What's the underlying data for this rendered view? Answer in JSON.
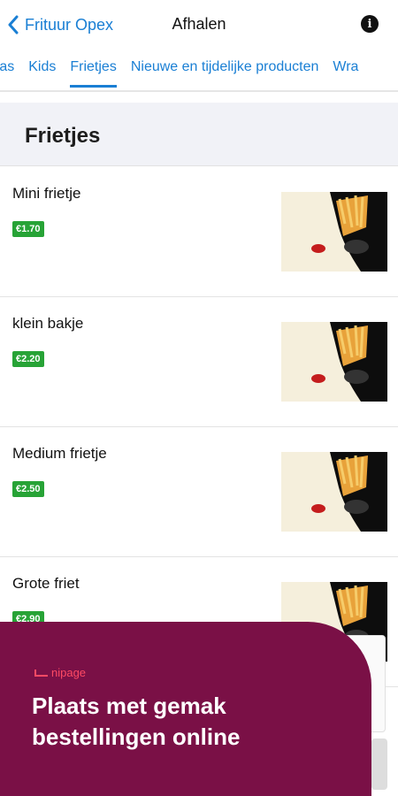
{
  "header": {
    "back_label": "Frituur Opex",
    "title": "Afhalen",
    "info_icon": "i"
  },
  "tabs": [
    {
      "label": "gtas",
      "active": false
    },
    {
      "label": "Kids",
      "active": false
    },
    {
      "label": "Frietjes",
      "active": true
    },
    {
      "label": "Nieuwe en tijdelijke producten",
      "active": false
    },
    {
      "label": "Wra",
      "active": false
    }
  ],
  "section": {
    "title": "Frietjes"
  },
  "items": [
    {
      "name": "Mini frietje",
      "price": "€1.70",
      "image_icon": "fries-cone-image"
    },
    {
      "name": "klein bakje",
      "price": "€2.20",
      "image_icon": "fries-cone-image"
    },
    {
      "name": "Medium frietje",
      "price": "€2.50",
      "image_icon": "fries-cone-image"
    },
    {
      "name": "Grote friet",
      "price": "€2.90",
      "image_icon": "fries-cone-image"
    }
  ],
  "promo": {
    "brand": "nipage",
    "text": "Plaats met gemak bestellingen online"
  },
  "colors": {
    "accent": "#1a7fd4",
    "price_badge": "#27a336",
    "promo_bg": "#7a1046",
    "promo_brand": "#ff4a64"
  }
}
